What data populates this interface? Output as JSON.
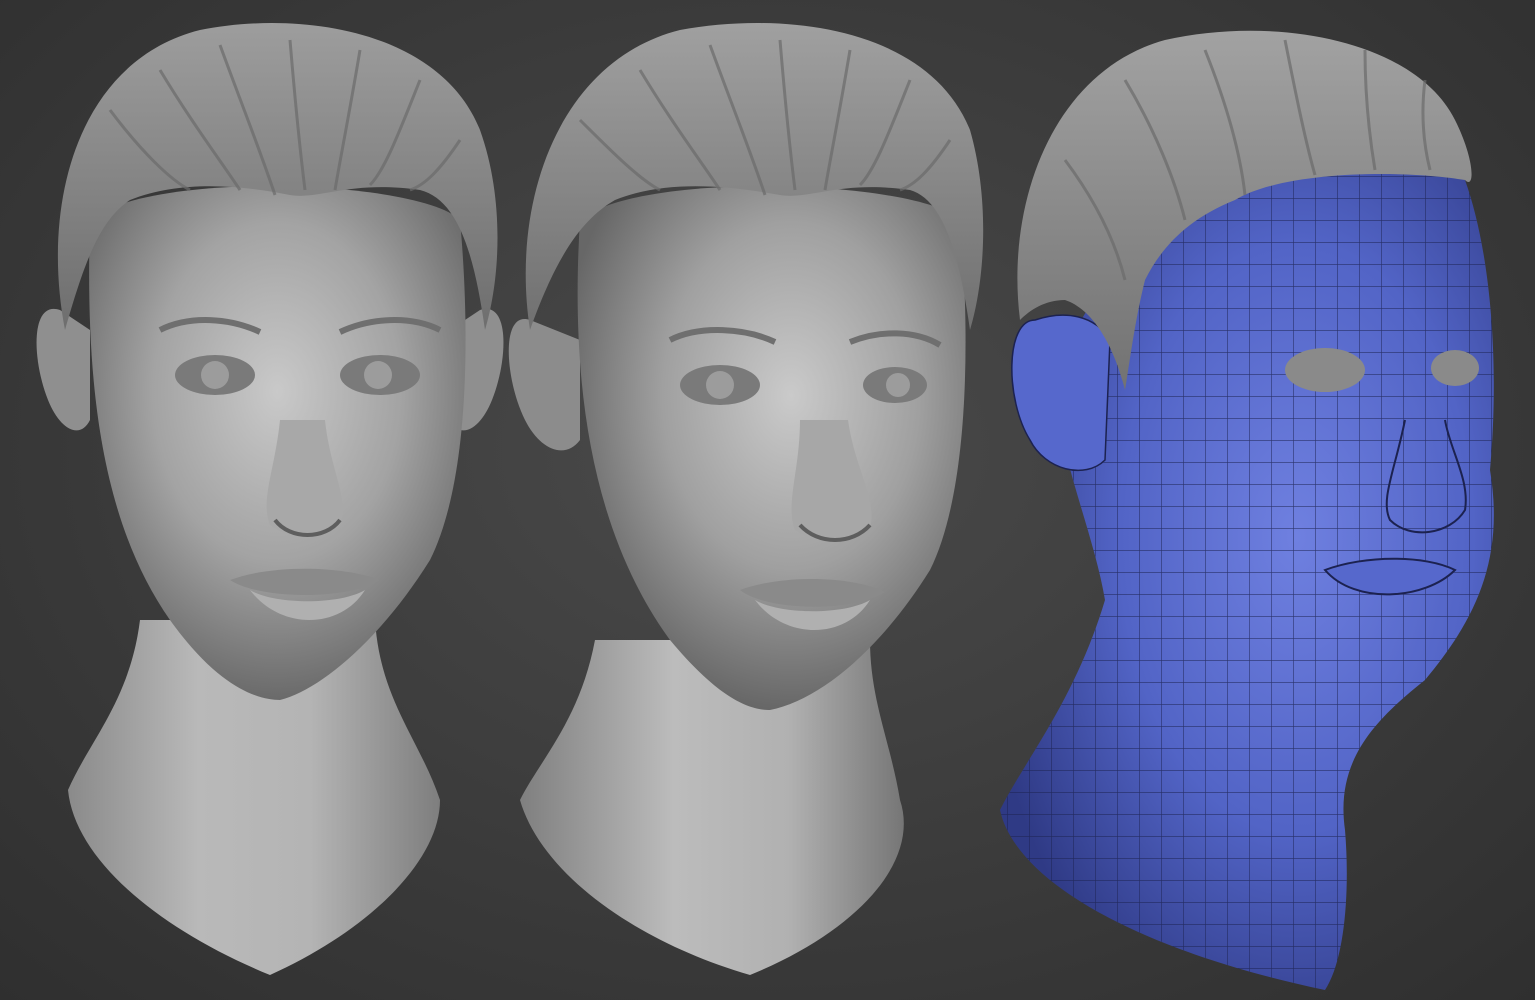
{
  "colors": {
    "background": "#3e3e3e",
    "clay": "#9a9a9a",
    "clay_light": "#c4c4c4",
    "clay_dark": "#5a5a5a",
    "topology_fill": "#5566c8",
    "topology_line": "#1a1f4a"
  },
  "views": [
    {
      "id": "front",
      "shading": "clay"
    },
    {
      "id": "three-quarter",
      "shading": "clay"
    },
    {
      "id": "three-quarter-right",
      "shading": "polygroup-wireframe"
    }
  ]
}
